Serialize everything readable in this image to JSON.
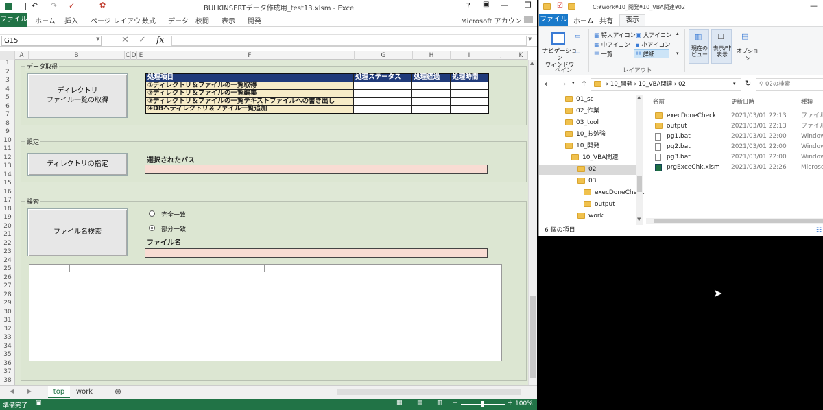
{
  "excel": {
    "title": "BULKINSERTデータ作成用_test13.xlsm - Excel",
    "ribbon_tabs": [
      "ファイル",
      "ホーム",
      "挿入",
      "ページ レイアウト",
      "数式",
      "データ",
      "校閲",
      "表示",
      "開発"
    ],
    "account": "Microsoft アカウント",
    "name_box": "G15",
    "fx": "fx",
    "columns": [
      "A",
      "B",
      "C",
      "D",
      "E",
      "F",
      "G",
      "H",
      "I",
      "J",
      "K"
    ],
    "rows": [
      "1",
      "2",
      "3",
      "4",
      "5",
      "6",
      "7",
      "8",
      "9",
      "10",
      "11",
      "12",
      "13",
      "14",
      "15",
      "16",
      "17",
      "18",
      "19",
      "20",
      "21",
      "22",
      "23",
      "24",
      "25",
      "26",
      "27",
      "28",
      "29",
      "30",
      "31",
      "32",
      "33",
      "34",
      "35",
      "36",
      "37",
      "38"
    ],
    "sections": {
      "data_fetch": "データ取得",
      "settings": "設定",
      "search": "検索"
    },
    "buttons": {
      "get_list": "ディレクトリ\nファイル一覧の取得",
      "set_dir": "ディレクトリの指定",
      "file_search": "ファイル名検索"
    },
    "process_table": {
      "headers": [
        "処理項目",
        "処理ステータス",
        "処理経過",
        "処理時間"
      ],
      "rows": [
        "①ディレクトリ＆ファイルの一覧取得",
        "②ディレクトリ＆ファイルの一覧編集",
        "③ディレクトリ＆ファイルの一覧テキストファイルへの書き出し",
        "④DBへディレクトリ＆ファイル一覧追加"
      ]
    },
    "selected_path_label": "選択されたパス",
    "selected_path_value": "",
    "radio": {
      "exact": "完全一致",
      "partial": "部分一致",
      "selected": "partial"
    },
    "file_name_label": "ファイル名",
    "file_name_value": "",
    "sheet_tabs": [
      "top",
      "work"
    ],
    "active_sheet": "top",
    "status": "準備完了",
    "zoom": "100%"
  },
  "explorer": {
    "title": "C:¥work¥10_開発¥10_VBA関連¥02",
    "tabs": [
      "ファイル",
      "ホーム",
      "共有",
      "表示"
    ],
    "active_tab": "表示",
    "ribbon": {
      "nav_pane": "ナビゲーション\nウィンドウ",
      "pane_group": "ペイン",
      "layout_options": [
        "特大アイコン",
        "大アイコン",
        "中アイコン",
        "小アイコン",
        "一覧",
        "詳細"
      ],
      "layout_group": "レイアウト",
      "current_view": "現在の\nビュー",
      "show_hide": "表示/非\n表示",
      "options": "オプション"
    },
    "address": [
      "10_開発",
      "10_VBA関連",
      "02"
    ],
    "search_placeholder": "02の検索",
    "nav_tree": [
      {
        "label": "01_sc",
        "indent": 0
      },
      {
        "label": "02_作業",
        "indent": 0
      },
      {
        "label": "03_tool",
        "indent": 0
      },
      {
        "label": "10_お勉強",
        "indent": 0
      },
      {
        "label": "10_開発",
        "indent": 0
      },
      {
        "label": "10_VBA関連",
        "indent": 1
      },
      {
        "label": "02",
        "indent": 2,
        "selected": true
      },
      {
        "label": "03",
        "indent": 2
      },
      {
        "label": "execDoneCheck",
        "indent": 3
      },
      {
        "label": "output",
        "indent": 3
      },
      {
        "label": "work",
        "indent": 2
      }
    ],
    "columns": [
      "名前",
      "更新日時",
      "種類"
    ],
    "files": [
      {
        "name": "execDoneCheck",
        "date": "2021/03/01 22:13",
        "type": "ファイル フ",
        "icon": "folder"
      },
      {
        "name": "output",
        "date": "2021/03/01 22:13",
        "type": "ファイル フ",
        "icon": "folder"
      },
      {
        "name": "pg1.bat",
        "date": "2021/03/01 22:00",
        "type": "Window",
        "icon": "file"
      },
      {
        "name": "pg2.bat",
        "date": "2021/03/01 22:00",
        "type": "Window",
        "icon": "file"
      },
      {
        "name": "pg3.bat",
        "date": "2021/03/01 22:00",
        "type": "Window",
        "icon": "file"
      },
      {
        "name": "prgExceChk.xlsm",
        "date": "2021/03/01 22:26",
        "type": "Microsoft",
        "icon": "xlsx"
      }
    ],
    "item_count": "6 個の項目"
  }
}
